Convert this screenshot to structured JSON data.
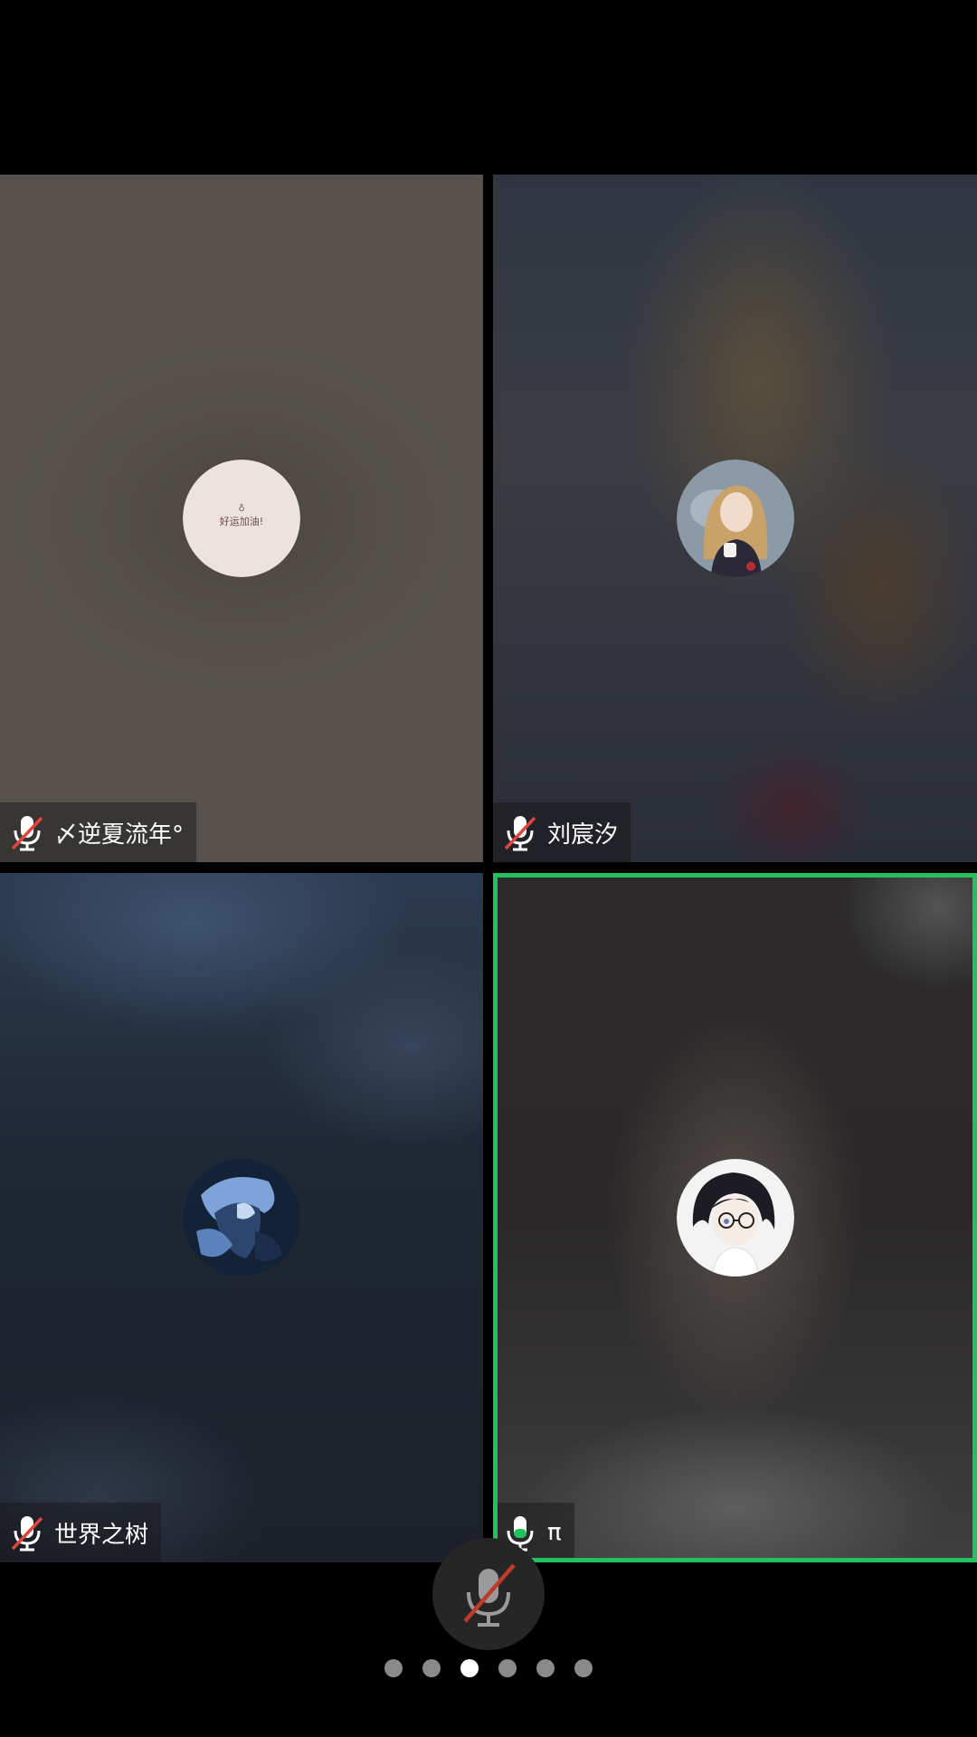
{
  "participants": [
    {
      "name": "〆逆夏流年°",
      "mic": "muted",
      "avatar": "avatar-handwritten-note",
      "avatar_text": "好运加油!"
    },
    {
      "name": "刘宸汐",
      "mic": "muted",
      "avatar": "avatar-curly-hair-girl"
    },
    {
      "name": "世界之树",
      "mic": "muted",
      "avatar": "avatar-blue-anime-character"
    },
    {
      "name": "π",
      "mic": "active",
      "avatar": "avatar-glasses-anime-character",
      "speaking": true
    }
  ],
  "controls": {
    "mic_button": "mic-muted-icon"
  },
  "pager": {
    "total": 6,
    "current": 3
  },
  "colors": {
    "active_speaker_border": "#22c15e",
    "muted_slash": "#e0453a",
    "active_mic": "#22c15e"
  }
}
